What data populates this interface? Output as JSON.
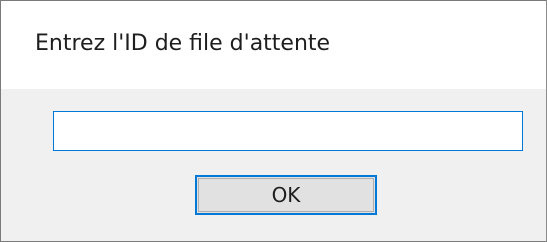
{
  "dialog": {
    "prompt": "Entrez l'ID de file d'attente",
    "input": {
      "value": "",
      "placeholder": ""
    },
    "ok_label": "OK"
  },
  "colors": {
    "accent": "#0078d7",
    "dialog_background": "#f0f0f0",
    "header_background": "#ffffff",
    "button_background": "#e1e1e1"
  }
}
